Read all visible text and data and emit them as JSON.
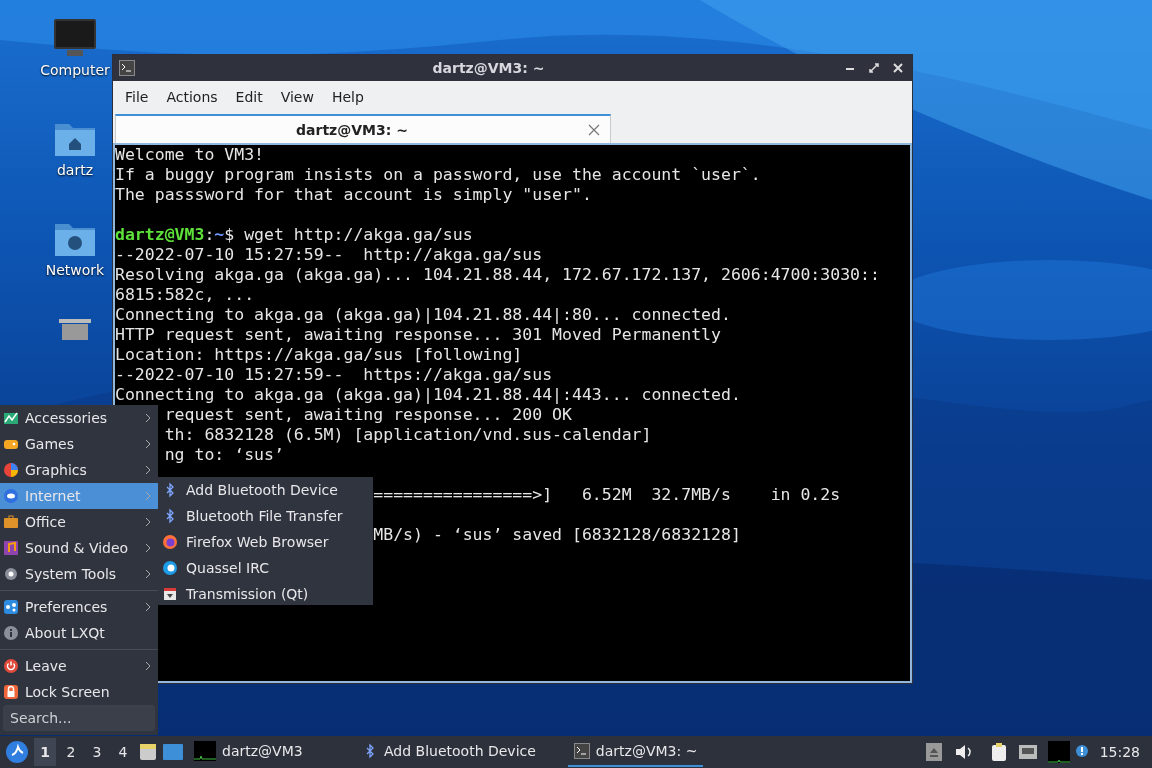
{
  "desktop_icons": [
    {
      "label": "Computer",
      "kind": "computer"
    },
    {
      "label": "dartz",
      "kind": "home"
    },
    {
      "label": "Network",
      "kind": "network"
    },
    {
      "kind": "trash"
    }
  ],
  "terminal": {
    "title": "dartz@VM3: ~",
    "menu": [
      "File",
      "Actions",
      "Edit",
      "View",
      "Help"
    ],
    "tabs": [
      {
        "label": "dartz@VM3: ~",
        "selected": true
      }
    ],
    "lines": [
      {
        "kind": "text",
        "text": "Welcome to VM3!"
      },
      {
        "kind": "text",
        "text": "If a buggy program insists on a password, use the account `user`."
      },
      {
        "kind": "text",
        "text": "The passsword for that account is simply \"user\"."
      },
      {
        "kind": "blank"
      },
      {
        "kind": "prompt",
        "user": "dartz@VM3",
        "sep": ":",
        "path": "~",
        "command": "$ wget http://akga.ga/sus"
      },
      {
        "kind": "text",
        "text": "--2022-07-10 15:27:59--  http://akga.ga/sus"
      },
      {
        "kind": "text",
        "text": "Resolving akga.ga (akga.ga)... 104.21.88.44, 172.67.172.137, 2606:4700:3030::"
      },
      {
        "kind": "text",
        "text": "6815:582c, ..."
      },
      {
        "kind": "text",
        "text": "Connecting to akga.ga (akga.ga)|104.21.88.44|:80... connected."
      },
      {
        "kind": "text",
        "text": "HTTP request sent, awaiting response... 301 Moved Permanently"
      },
      {
        "kind": "text",
        "text": "Location: https://akga.ga/sus [following]"
      },
      {
        "kind": "text",
        "text": "--2022-07-10 15:27:59--  https://akga.ga/sus"
      },
      {
        "kind": "text",
        "text": "Connecting to akga.ga (akga.ga)|104.21.88.44|:443... connected."
      },
      {
        "kind": "text",
        "text": "     request sent, awaiting response... 200 OK"
      },
      {
        "kind": "text",
        "text": "     th: 6832128 (6.5M) [application/vnd.sus-calendar]"
      },
      {
        "kind": "text",
        "text": "     ng to: ‘sus’"
      },
      {
        "kind": "blank"
      },
      {
        "kind": "text",
        "text": "                          ================>]   6.52M  32.7MB/s    in 0.2s"
      },
      {
        "kind": "blank"
      },
      {
        "kind": "text",
        "text": "                          MB/s) - ‘sus’ saved [6832128/6832128]"
      }
    ]
  },
  "menu": {
    "items": [
      {
        "kind": "accessories",
        "label": "Accessories",
        "submenu": true,
        "selected": false
      },
      {
        "kind": "games",
        "label": "Games",
        "submenu": true,
        "selected": false
      },
      {
        "kind": "graphics",
        "label": "Graphics",
        "submenu": true,
        "selected": false
      },
      {
        "kind": "internet",
        "label": "Internet",
        "submenu": true,
        "selected": true
      },
      {
        "kind": "office",
        "label": "Office",
        "submenu": true,
        "selected": false
      },
      {
        "kind": "sound",
        "label": "Sound & Video",
        "submenu": true,
        "selected": false
      },
      {
        "kind": "system",
        "label": "System Tools",
        "submenu": true,
        "selected": false
      },
      {
        "kind": "separator"
      },
      {
        "kind": "preferences",
        "label": "Preferences",
        "submenu": true,
        "selected": false
      },
      {
        "kind": "about",
        "label": "About LXQt",
        "submenu": false,
        "selected": false
      },
      {
        "kind": "separator"
      },
      {
        "kind": "leave",
        "label": "Leave",
        "submenu": true,
        "selected": false
      },
      {
        "kind": "lock",
        "label": "Lock Screen",
        "submenu": false,
        "selected": false
      }
    ],
    "search": {
      "placeholder": "Search..."
    },
    "submenu": [
      {
        "kind": "bluetooth",
        "label": "Add Bluetooth Device"
      },
      {
        "kind": "bluetooth",
        "label": "Bluetooth File Transfer"
      },
      {
        "kind": "firefox",
        "label": "Firefox Web Browser"
      },
      {
        "kind": "quassel",
        "label": "Quassel IRC"
      },
      {
        "kind": "transmission",
        "label": "Transmission (Qt)"
      }
    ]
  },
  "taskbar": {
    "workspaces": [
      {
        "label": "1",
        "selected": true
      },
      {
        "label": "2",
        "selected": false
      },
      {
        "label": "3",
        "selected": false
      },
      {
        "label": "4",
        "selected": false
      }
    ],
    "tasks": [
      {
        "kind": "monitor",
        "label": "dartz@VM3",
        "selected": false
      },
      {
        "kind": "bluetooth",
        "label": "Add Bluetooth Device",
        "selected": false
      },
      {
        "kind": "terminal",
        "label": "dartz@VM3: ~",
        "selected": true
      }
    ],
    "clock": "15:28"
  }
}
